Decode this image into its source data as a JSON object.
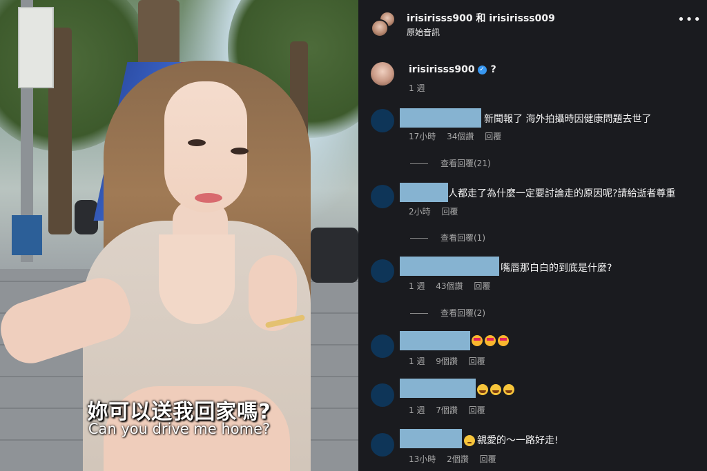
{
  "video": {
    "subtitle_zh": "妳可以送我回家嗎?",
    "subtitle_en": "Can you drive me home?"
  },
  "header": {
    "title": "irisirisss900 和 irisirisss009",
    "subtitle": "原始音訊",
    "more_icon": "more-horizontal-icon"
  },
  "caption": {
    "username": "irisirisss900",
    "text": "?",
    "time": "1 週",
    "verified_icon": "verified-badge-icon"
  },
  "comments": [
    {
      "text": "新聞報了 海外拍攝時因健康問題去世了",
      "time": "17小時",
      "likes": "34個讚",
      "reply": "回覆",
      "view_replies": "查看回覆(21)"
    },
    {
      "text": "人都走了為什麼一定要討論走的原因呢?請給逝者尊重",
      "time": "2小時",
      "likes": "",
      "reply": "回覆",
      "view_replies": "查看回覆(1)"
    },
    {
      "text": "嘴唇那白白的到底是什麼?",
      "time": "1 週",
      "likes": "43個讚",
      "reply": "回覆",
      "view_replies": "查看回覆(2)"
    },
    {
      "text": "",
      "emoji": [
        "heart-eyes-emoji",
        "heart-eyes-emoji",
        "heart-eyes-emoji"
      ],
      "time": "1 週",
      "likes": "9個讚",
      "reply": "回覆"
    },
    {
      "text": "",
      "emoji": [
        "tears-of-joy-emoji",
        "tears-of-joy-emoji",
        "tears-of-joy-emoji"
      ],
      "time": "1 週",
      "likes": "7個讚",
      "reply": "回覆"
    },
    {
      "text": "親愛的～一路好走!",
      "emoji_lead": "sad-face-emoji",
      "time": "13小時",
      "likes": "2個讚",
      "reply": "回覆"
    }
  ],
  "colors": {
    "panel_bg": "#1a1b1f",
    "redaction_bar": "#86b3d1",
    "avatar_placeholder": "#0e3558",
    "meta_text": "#a8a8a8"
  }
}
